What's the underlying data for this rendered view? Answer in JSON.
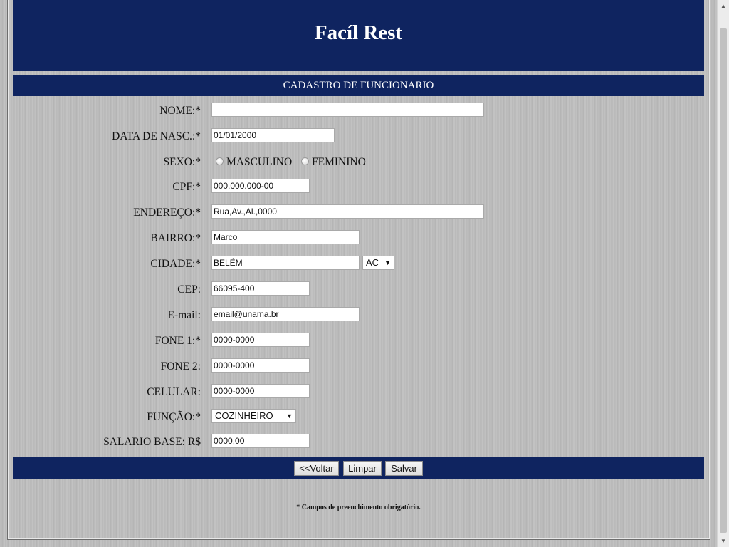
{
  "header": {
    "title": "Facíl Rest"
  },
  "form": {
    "section_title": "CADASTRO DE FUNCIONARIO",
    "nome_label": "NOME:*",
    "nome_value": "",
    "data_nasc_label": "DATA DE NASC.:*",
    "data_nasc_value": "01/01/2000",
    "sexo_label": "SEXO:*",
    "sexo_options": [
      "MASCULINO",
      "FEMININO"
    ],
    "cpf_label": "CPF:*",
    "cpf_value": "000.000.000-00",
    "endereco_label": "ENDEREÇO:*",
    "endereco_value": "Rua,Av.,Al.,0000",
    "bairro_label": "BAIRRO:*",
    "bairro_value": "Marco",
    "cidade_label": "CIDADE:*",
    "cidade_value": "BELÉM",
    "uf_selected": "AC",
    "cep_label": "CEP:",
    "cep_value": "66095-400",
    "email_label": "E-mail:",
    "email_value": "email@unama.br",
    "fone1_label": "FONE 1:*",
    "fone1_value": "0000-0000",
    "fone2_label": "FONE 2:",
    "fone2_value": "0000-0000",
    "celular_label": "CELULAR:",
    "celular_value": "0000-0000",
    "funcao_label": "FUNÇÃO:*",
    "funcao_selected": "COZINHEIRO",
    "salario_label": "SALARIO BASE: R$",
    "salario_value": "0000,00"
  },
  "actions": {
    "back_label": "<<Voltar",
    "clear_label": "Limpar",
    "save_label": "Salvar"
  },
  "footnote": "* Campos de preenchimento obrigatório.",
  "colors": {
    "header_bg": "#0f2460",
    "header_text": "#ffffff"
  }
}
